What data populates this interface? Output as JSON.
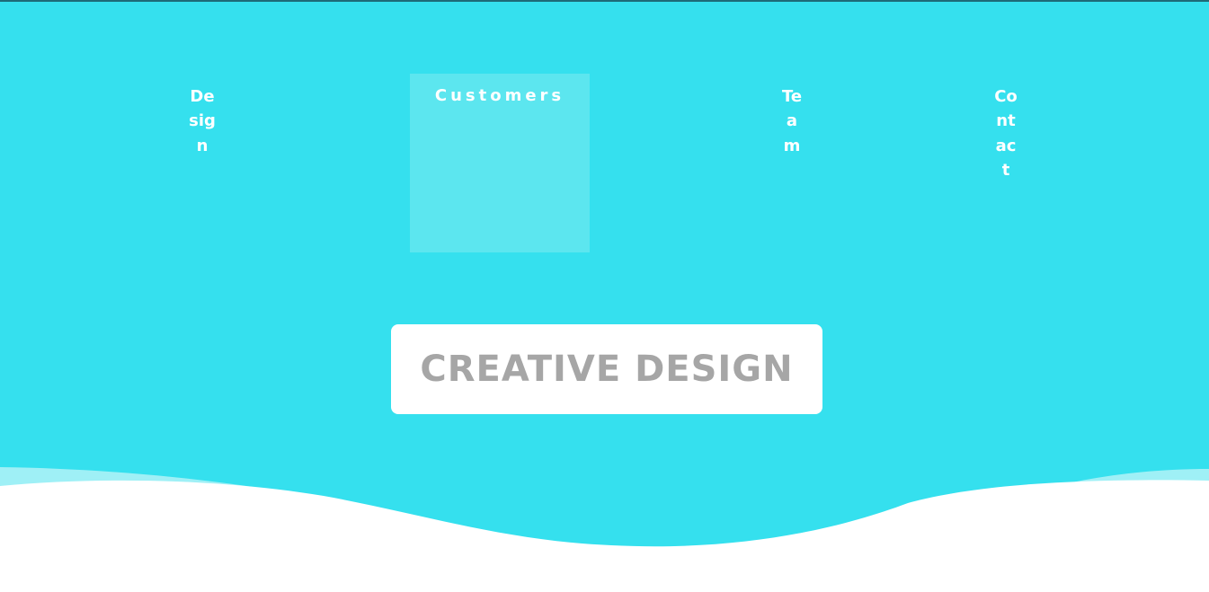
{
  "colors": {
    "background": "#35e0ee",
    "wave_light": "#9ff0f6",
    "wave_white": "#ffffff",
    "nav_text": "#ffffff",
    "nav_active_bg": "#5ce6ef",
    "cta_bg": "#ffffff",
    "cta_text": "#a6a6a6"
  },
  "nav": {
    "items": [
      {
        "label": "Design",
        "active": false
      },
      {
        "label": "Customers",
        "active": true
      },
      {
        "label": "Team",
        "active": false
      },
      {
        "label": "Contact",
        "active": false
      }
    ]
  },
  "cta": {
    "label": "CREATIVE DESIGN"
  }
}
